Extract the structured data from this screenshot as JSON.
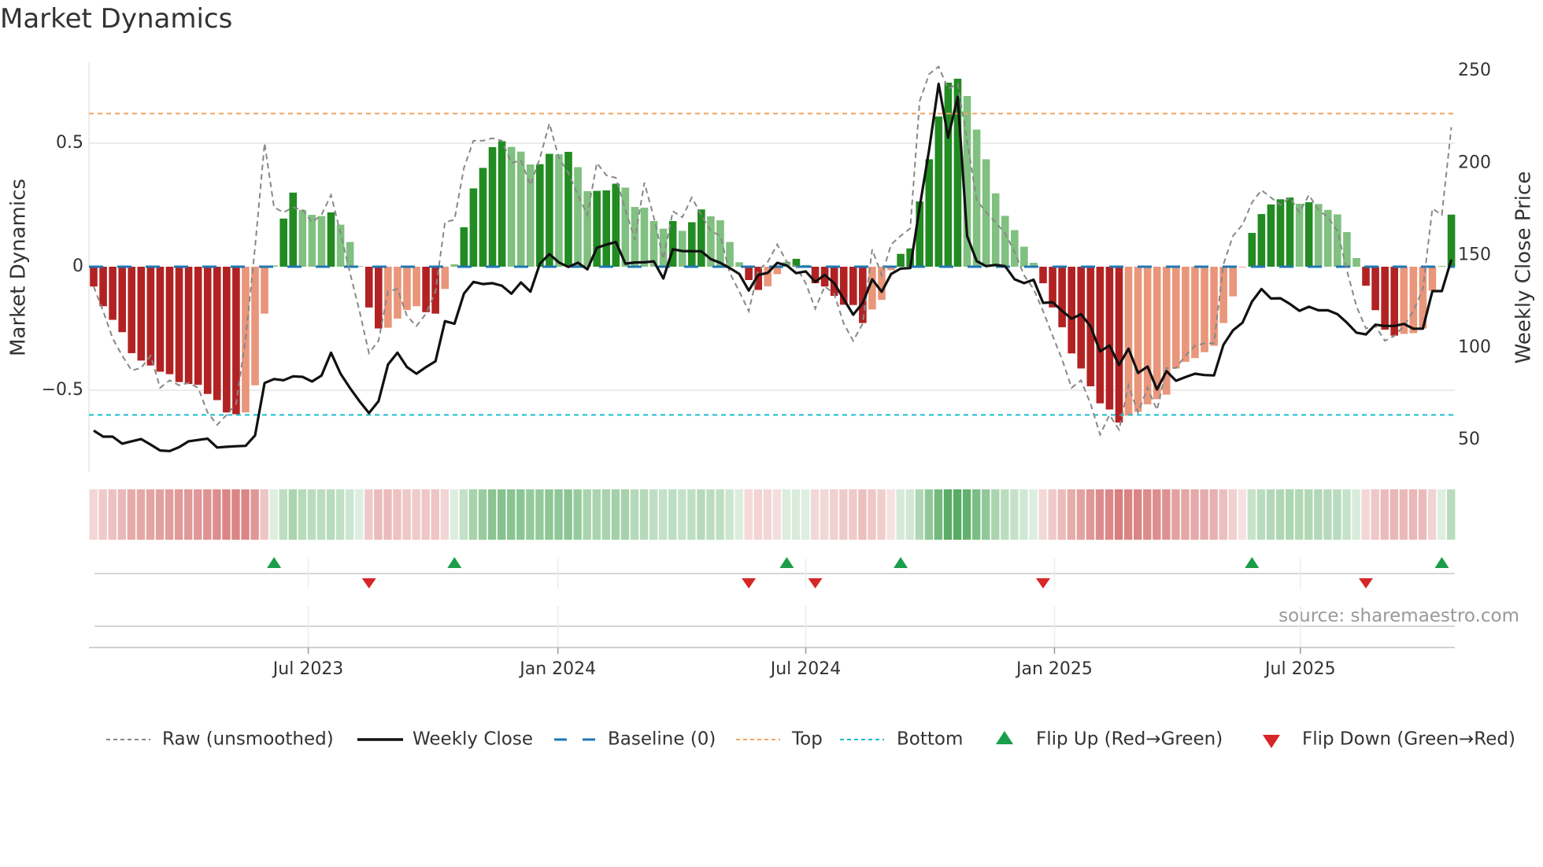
{
  "title": "Market Dynamics",
  "source": "source: sharemaestro.com",
  "colors": {
    "green_dark": "#228b22",
    "green_light": "#80c080",
    "red_dark": "#b22222",
    "red_light": "#e9967a",
    "baseline": "#1f77b4",
    "top": "#f4a460",
    "bottom": "#17becf",
    "raw": "#888888",
    "close": "#111111",
    "flip_up": "#1a9e4a",
    "flip_down": "#d62728"
  },
  "chart_data": {
    "type": "bar",
    "title": "Market Dynamics",
    "ylabel": "Market Dynamics",
    "y2label": "Weekly Close Price",
    "ylim": [
      -0.8,
      0.83
    ],
    "y2lim": [
      35,
      270
    ],
    "yticks": [
      {
        "value": 0.5,
        "label": "0.5"
      },
      {
        "value": 0,
        "label": "0"
      },
      {
        "value": -0.5,
        "label": "−0.5"
      }
    ],
    "y2ticks": [
      {
        "value": 250,
        "label": "250"
      },
      {
        "value": 200,
        "label": "200"
      },
      {
        "value": 150,
        "label": "150"
      },
      {
        "value": 100,
        "label": "100"
      },
      {
        "value": 50,
        "label": "50"
      }
    ],
    "xticks": [
      {
        "week": 22.6,
        "label": "Jul 2023"
      },
      {
        "week": 48.9,
        "label": "Jan 2024"
      },
      {
        "week": 75.0,
        "label": "Jul 2024"
      },
      {
        "week": 101.2,
        "label": "Jan 2025"
      },
      {
        "week": 127.1,
        "label": "Jul 2025"
      }
    ],
    "top_level": 0.62,
    "bottom_level": -0.6,
    "baseline": 0,
    "grid": true,
    "legend_position": "bottom",
    "legend": [
      {
        "key": "raw",
        "label": "Raw (unsmoothed)"
      },
      {
        "key": "close",
        "label": "Weekly Close"
      },
      {
        "key": "baseline",
        "label": "Baseline (0)"
      },
      {
        "key": "top",
        "label": "Top"
      },
      {
        "key": "bottom",
        "label": "Bottom"
      },
      {
        "key": "flip_up",
        "label": "Flip Up (Red→Green)"
      },
      {
        "key": "flip_down",
        "label": "Flip Down (Green→Red)"
      }
    ],
    "smoothed": [
      -0.08,
      -0.16,
      -0.215,
      -0.265,
      -0.35,
      -0.38,
      -0.4,
      -0.425,
      -0.435,
      -0.467,
      -0.475,
      -0.478,
      -0.515,
      -0.54,
      -0.59,
      -0.597,
      -0.59,
      -0.48,
      -0.19,
      0.005,
      0.195,
      0.3,
      0.23,
      0.21,
      0.205,
      0.22,
      0.17,
      0.1,
      0.003,
      -0.165,
      -0.25,
      -0.247,
      -0.21,
      -0.175,
      -0.16,
      -0.184,
      -0.19,
      -0.09,
      0.01,
      0.16,
      0.317,
      0.4,
      0.484,
      0.508,
      0.485,
      0.466,
      0.414,
      0.415,
      0.457,
      0.455,
      0.465,
      0.403,
      0.306,
      0.307,
      0.309,
      0.336,
      0.32,
      0.242,
      0.239,
      0.185,
      0.154,
      0.185,
      0.145,
      0.18,
      0.232,
      0.204,
      0.188,
      0.1,
      0.018,
      -0.054,
      -0.094,
      -0.079,
      -0.03,
      0.02,
      0.032,
      0.007,
      -0.067,
      -0.08,
      -0.118,
      -0.154,
      -0.155,
      -0.228,
      -0.173,
      -0.134,
      -0.014,
      0.052,
      0.074,
      0.264,
      0.435,
      0.608,
      0.745,
      0.761,
      0.691,
      0.555,
      0.435,
      0.297,
      0.206,
      0.148,
      0.081,
      0.016,
      -0.067,
      -0.165,
      -0.245,
      -0.351,
      -0.412,
      -0.484,
      -0.553,
      -0.578,
      -0.631,
      -0.603,
      -0.587,
      -0.557,
      -0.536,
      -0.518,
      -0.412,
      -0.385,
      -0.37,
      -0.346,
      -0.32,
      -0.228,
      -0.12,
      -0.003,
      0.137,
      0.213,
      0.252,
      0.273,
      0.28,
      0.255,
      0.261,
      0.254,
      0.23,
      0.212,
      0.14,
      0.035,
      -0.077,
      -0.176,
      -0.255,
      -0.279,
      -0.272,
      -0.269,
      -0.25,
      -0.097,
      0.003,
      0.211
    ],
    "raw": [
      -0.08,
      -0.18,
      -0.29,
      -0.36,
      -0.42,
      -0.41,
      -0.36,
      -0.49,
      -0.46,
      -0.48,
      -0.47,
      -0.49,
      -0.59,
      -0.64,
      -0.6,
      -0.555,
      -0.29,
      0.08,
      0.5,
      0.24,
      0.22,
      0.24,
      0.23,
      0.18,
      0.21,
      0.29,
      0.135,
      -0.025,
      -0.18,
      -0.35,
      -0.3,
      -0.1,
      -0.09,
      -0.2,
      -0.24,
      -0.19,
      -0.1,
      0.18,
      0.19,
      0.4,
      0.51,
      0.51,
      0.52,
      0.51,
      0.42,
      0.43,
      0.33,
      0.44,
      0.58,
      0.44,
      0.38,
      0.29,
      0.21,
      0.42,
      0.37,
      0.36,
      0.23,
      0.11,
      0.34,
      0.2,
      0.03,
      0.225,
      0.2,
      0.28,
      0.21,
      0.145,
      0.125,
      -0.025,
      -0.1,
      -0.18,
      -0.015,
      0.02,
      0.09,
      0.02,
      0,
      -0.067,
      -0.17,
      -0.08,
      -0.11,
      -0.23,
      -0.3,
      -0.23,
      0.07,
      -0.035,
      0.09,
      0.125,
      0.155,
      0.67,
      0.78,
      0.81,
      0.72,
      0.74,
      0.51,
      0.27,
      0.22,
      0.18,
      0.135,
      0.06,
      -0.035,
      -0.09,
      -0.18,
      -0.28,
      -0.375,
      -0.49,
      -0.46,
      -0.555,
      -0.68,
      -0.6,
      -0.66,
      -0.48,
      -0.59,
      -0.49,
      -0.58,
      -0.41,
      -0.41,
      -0.36,
      -0.32,
      -0.31,
      -0.31,
      0.01,
      0.125,
      0.17,
      0.26,
      0.31,
      0.28,
      0.25,
      0.28,
      0.22,
      0.29,
      0.23,
      0.2,
      0.145,
      -0.015,
      -0.16,
      -0.25,
      -0.24,
      -0.3,
      -0.28,
      -0.24,
      -0.18,
      -0.09,
      0.235,
      0.21,
      0.565
    ],
    "close": [
      55.0,
      51.7,
      51.7,
      47.9,
      49.2,
      50.4,
      47.4,
      44.2,
      43.9,
      46.0,
      49.2,
      49.9,
      50.6,
      45.8,
      46.2,
      46.5,
      46.7,
      52.4,
      80.8,
      82.9,
      82.3,
      84.4,
      84.1,
      81.6,
      84.8,
      97.2,
      85.8,
      78.0,
      70.9,
      64.5,
      70.9,
      90.8,
      97.2,
      89.4,
      85.8,
      89.4,
      92.6,
      114.3,
      112.9,
      129.2,
      135.6,
      134.4,
      134.9,
      133.5,
      129.2,
      135.3,
      130.3,
      145.5,
      150.7,
      146.1,
      143.7,
      146.0,
      142.4,
      154.1,
      155.8,
      157.2,
      145.5,
      146.1,
      146.2,
      146.7,
      137.4,
      153.3,
      152.3,
      152.2,
      152.2,
      147.9,
      145.9,
      143.1,
      139.9,
      130.9,
      139.4,
      140.5,
      145.9,
      144.5,
      140.3,
      141.3,
      135.6,
      139.4,
      134.9,
      126.3,
      117.8,
      124.2,
      137.0,
      130.2,
      139.9,
      142.8,
      143.1,
      176.0,
      207.4,
      242.9,
      213.8,
      235.8,
      160.4,
      146.9,
      144.1,
      144.8,
      144.1,
      137.0,
      134.9,
      136.8,
      124.2,
      124.6,
      119.9,
      115.6,
      118.1,
      111.4,
      97.9,
      101.1,
      90.5,
      99.4,
      86.2,
      89.7,
      77.3,
      87.2,
      82.0,
      84.0,
      85.8,
      85.1,
      84.9,
      101.5,
      109.3,
      113.5,
      124.9,
      131.7,
      126.6,
      126.7,
      123.6,
      119.9,
      122.1,
      120.2,
      120.2,
      118.1,
      113.5,
      108.1,
      107.1,
      112.4,
      111.7,
      111.7,
      112.8,
      110.2,
      110.2,
      130.6,
      130.6,
      147.7
    ]
  }
}
